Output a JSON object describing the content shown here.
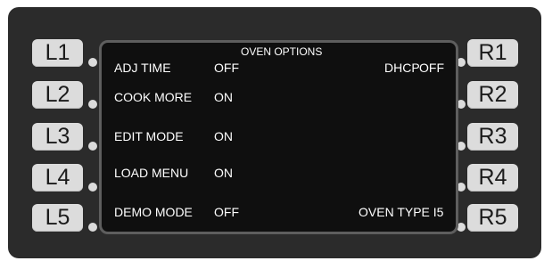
{
  "left_keys": [
    "L1",
    "L2",
    "L3",
    "L4",
    "L5"
  ],
  "right_keys": [
    "R1",
    "R2",
    "R3",
    "R4",
    "R5"
  ],
  "screen": {
    "title": "OVEN OPTIONS",
    "rows": [
      {
        "label": "ADJ TIME",
        "value": "OFF"
      },
      {
        "label": "COOK MORE",
        "value": "ON"
      },
      {
        "label": "EDIT MODE",
        "value": "ON"
      },
      {
        "label": "LOAD MENU",
        "value": "ON"
      },
      {
        "label": "DEMO MODE",
        "value": "OFF"
      }
    ],
    "dhcp_label": "DHCP",
    "dhcp_value": "OFF",
    "oven_type": "OVEN TYPE I5"
  },
  "colors": {
    "bezel": "#2b2b2b",
    "key": "#dcdcdc",
    "screen": "#0f0f0f",
    "screen_border": "#5e5e5e",
    "text": "#ffffff"
  }
}
